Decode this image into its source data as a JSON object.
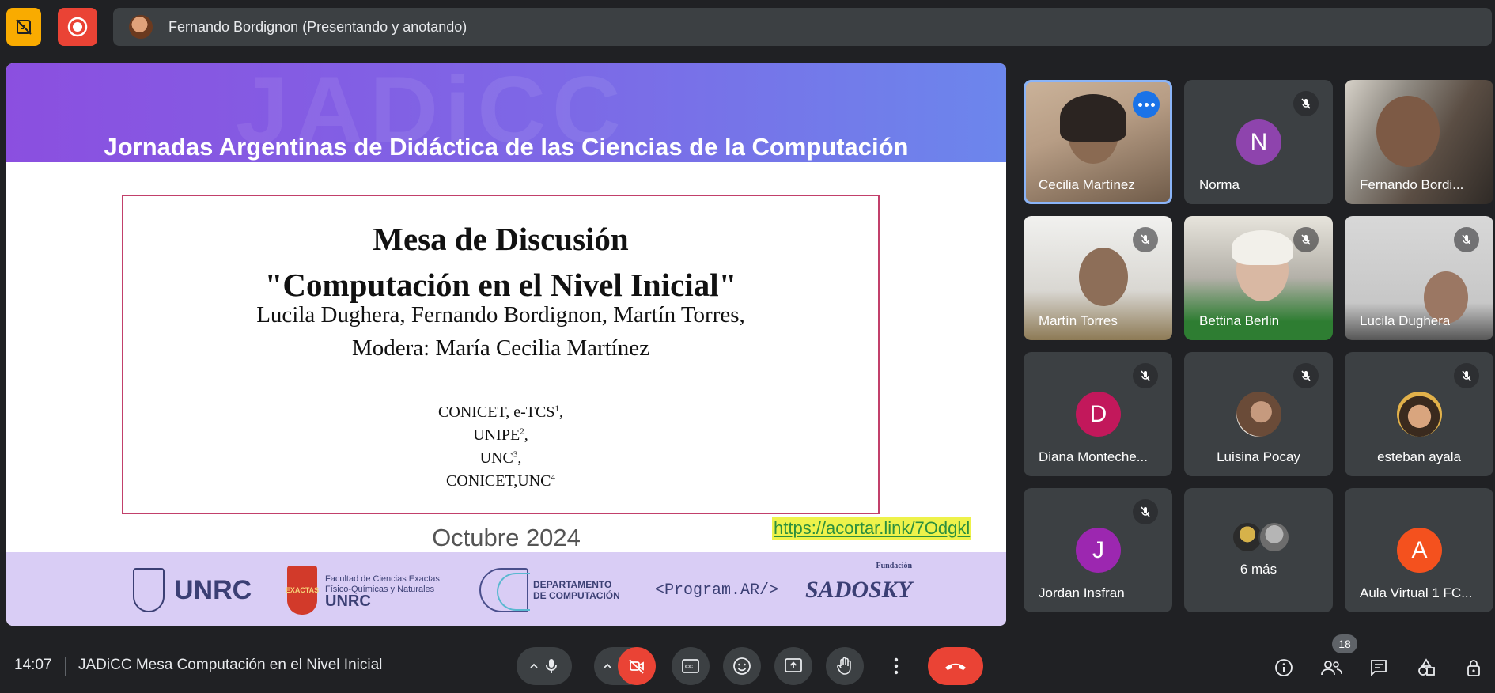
{
  "presenter_bar": {
    "text": "Fernando Bordignon (Presentando y anotando)"
  },
  "slide": {
    "watermark": "JADiCC",
    "header_title": "Jornadas Argentinas de Didáctica de las Ciencias de la Computación",
    "title_line1": "Mesa de Discusión",
    "title_line2": "\"Computación en el Nivel Inicial\"",
    "authors": "Lucila Dughera, Fernando Bordignon, Martín Torres,",
    "moderator": "Modera: María Cecilia Martínez",
    "affiliations": [
      {
        "text": "CONICET, e-TCS",
        "sup": "1",
        "suffix": ","
      },
      {
        "text": "UNIPE",
        "sup": "2",
        "suffix": ","
      },
      {
        "text": "UNC",
        "sup": "3",
        "suffix": ","
      },
      {
        "text": "CONICET,UNC",
        "sup": "4",
        "suffix": ""
      }
    ],
    "date": "Octubre 2024",
    "link": "https://acortar.link/7Odgkl",
    "logos": {
      "unrc": "UNRC",
      "exactas_lines": [
        "Facultad de Ciencias Exactas",
        "Físico-Químicas y Naturales"
      ],
      "exactas_unrc": "UNRC",
      "exactas_shield": "EXACTAS",
      "dc_line1": "DEPARTAMENTO",
      "dc_line2": "DE COMPUTACIÓN",
      "program_ar": "<Program.AR/>",
      "sadosky_small": "Fundación",
      "sadosky": "SADOSKY"
    }
  },
  "participants": [
    {
      "name": "Cecilia Martínez",
      "type": "video",
      "active": true
    },
    {
      "name": "Norma",
      "type": "initial",
      "initial": "N",
      "color": "#8e44ad"
    },
    {
      "name": "Fernando Bordi...",
      "type": "video"
    },
    {
      "name": "Martín Torres",
      "type": "video"
    },
    {
      "name": "Bettina Berlin",
      "type": "video"
    },
    {
      "name": "Lucila Dughera",
      "type": "video"
    },
    {
      "name": "Diana Monteche...",
      "type": "initial",
      "initial": "D",
      "color": "#c2185b"
    },
    {
      "name": "Luisina Pocay",
      "type": "avatar"
    },
    {
      "name": "esteban ayala",
      "type": "avatar"
    },
    {
      "name": "Jordan Insfran",
      "type": "initial",
      "initial": "J",
      "color": "#9c27b0"
    },
    {
      "name": "6 más",
      "type": "more"
    },
    {
      "name": "Aula Virtual 1 FC...",
      "type": "initial",
      "initial": "A",
      "color": "#f4511e"
    }
  ],
  "bottom_bar": {
    "time": "14:07",
    "meeting_title": "JADiCC Mesa Computación en el Nivel Inicial",
    "participant_count": "18"
  },
  "colors": {
    "background": "#202124",
    "tile": "#3c4043",
    "danger": "#ea4335",
    "accent": "#8ab4f8",
    "warning": "#f9ab00"
  }
}
